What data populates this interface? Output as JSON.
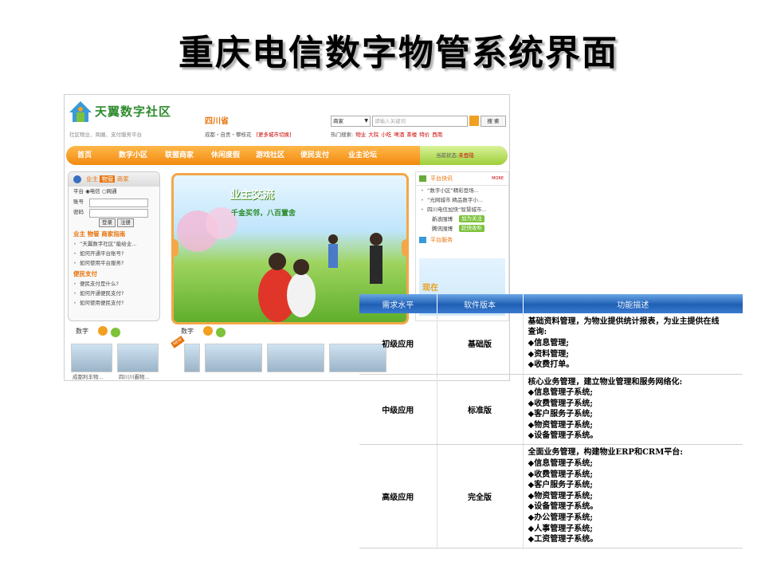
{
  "slide": {
    "title": "重庆电信数字物管系统界面"
  },
  "site": {
    "logo_text": "天翼数字社区",
    "logo_sub": "社区物业、商圈、支付服务平台",
    "province": "四川省",
    "cities": "成都・自贡・攀枝花",
    "switch_city": "[更多城市切换]",
    "search_category": "商家",
    "search_placeholder": "请输入关键词",
    "search_button": "搜 索",
    "hot_label": "热门搜索:",
    "hot_terms": [
      "物业",
      "大院",
      "小吃",
      "啤酒",
      "茶楼",
      "特价",
      "西南"
    ],
    "nav": [
      "首页",
      "数字小区",
      "联盟商家",
      "休闲度假",
      "游戏社区",
      "便民支付",
      "业主论坛"
    ],
    "login_status_label": "当前状态:",
    "login_status_value": "未登陆",
    "login_tabs": [
      "业主",
      "物管",
      "商家"
    ],
    "platform_label": "平台",
    "platform_options": [
      "电信",
      "网通"
    ],
    "account_label": "账号",
    "password_label": "密码",
    "login_button": "登录",
    "register_button": "注册",
    "guide_title": "业主 物管 商家指南",
    "guide_items": [
      "“天翼数字社区”能给业...",
      "如何开通平台账号?",
      "如何使用平台服务?"
    ],
    "pay_title": "便民支付",
    "pay_items": [
      "便民支付是什么?",
      "如何开通便民支付?",
      "如何使用便民支付?"
    ],
    "banner_title": "业主交流",
    "banner_subtitle": "千金买邻，八百置舍",
    "news_title": "平台快讯",
    "news_more": "MORE",
    "news_items": [
      "“数字小区”精彩登场...",
      "“光网城市 精品数字小...",
      "四川电信加快“智慧城市..."
    ],
    "follow_rows": [
      {
        "label": "新浪围博",
        "button": "加为关注"
      },
      {
        "label": "腾讯围博",
        "button": "赶快收听"
      }
    ],
    "service_title": "平台服务",
    "service_now": "现在",
    "bottom_left_title": "数字",
    "bottom_left_captions": [
      "成都利丰物...",
      "四川川霸物..."
    ],
    "bottom_right_title": "数字",
    "new_tag": "NEW"
  },
  "table": {
    "headers": [
      "需求水平",
      "软件版本",
      "功能描述"
    ],
    "rows": [
      {
        "level": "初级应用",
        "version": "基础版",
        "lines": [
          "基础资料管理，为物业提供统计报表，为业主提供在线",
          "查询:",
          "◆信息管理;",
          "◆资料管理;",
          "◆收费打单。"
        ]
      },
      {
        "level": "中级应用",
        "version": "标准版",
        "lines": [
          "核心业务管理，建立物业管理和服务网络化:",
          "◆信息管理子系统;",
          "◆收费管理子系统;",
          "◆客户服务子系统;",
          "◆物资管理子系统;",
          "◆设备管理子系统。"
        ]
      },
      {
        "level": "高级应用",
        "version": "完全版",
        "lines": [
          "全面业务管理，构建物业ERP和CRM平台:",
          "◆信息管理子系统;",
          "◆收费管理子系统;",
          "◆客户服务子系统;",
          "◆物资管理子系统;",
          "◆设备管理子系统。",
          "◆办公管理子系统;",
          "◆人事管理子系统;",
          "◆工资管理子系统。"
        ]
      }
    ]
  },
  "colors": {
    "accent_orange": "#f28a10",
    "table_header_blue": "#1f5fb4",
    "brand_green": "#2e8b2e"
  }
}
